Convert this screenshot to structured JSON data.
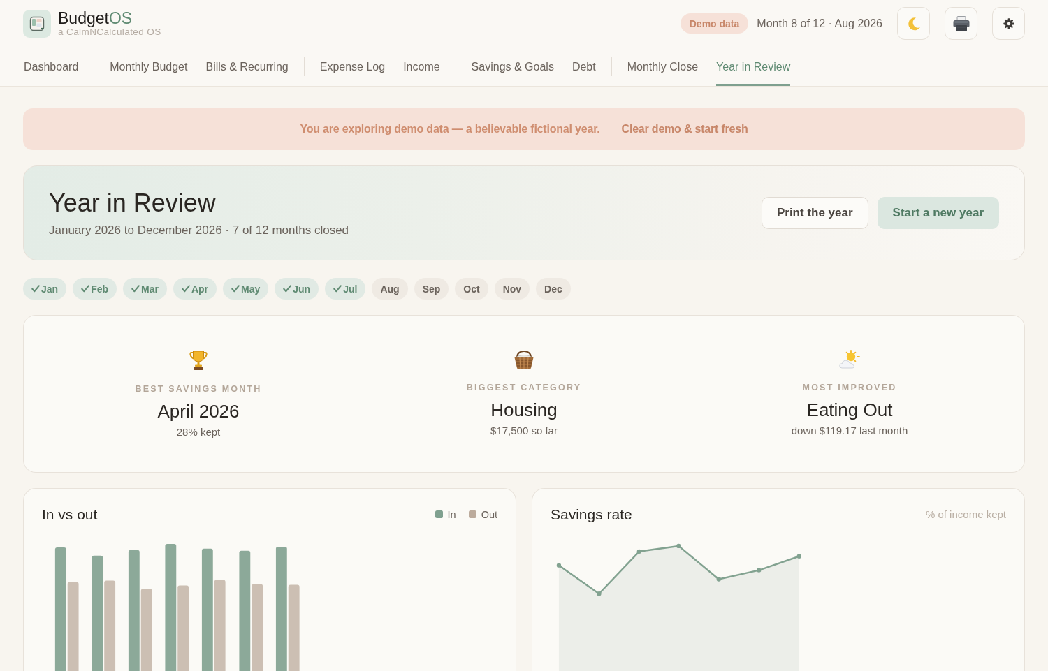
{
  "header": {
    "brand": {
      "name": "Budget",
      "accent": "OS",
      "tagline": "a CalmNCalculated OS"
    },
    "badge": "Demo data",
    "period": "Month 8 of 12 · Aug 2026"
  },
  "nav": {
    "groups": [
      {
        "items": [
          {
            "label": "Dashboard",
            "selected": false
          }
        ]
      },
      {
        "items": [
          {
            "label": "Monthly Budget",
            "selected": false
          },
          {
            "label": "Bills & Recurring",
            "selected": false
          }
        ]
      },
      {
        "items": [
          {
            "label": "Expense Log",
            "selected": false
          },
          {
            "label": "Income",
            "selected": false
          }
        ]
      },
      {
        "items": [
          {
            "label": "Savings & Goals",
            "selected": false
          },
          {
            "label": "Debt",
            "selected": false
          }
        ]
      },
      {
        "items": [
          {
            "label": "Monthly Close",
            "selected": false
          },
          {
            "label": "Year in Review",
            "selected": true
          }
        ]
      }
    ]
  },
  "banner": {
    "message": "You are exploring demo data — a believable fictional year.",
    "link": "Clear demo & start fresh"
  },
  "hero": {
    "title": "Year in Review",
    "subtitle": "January 2026 to December 2026 · 7 of 12 months closed",
    "buttons": [
      {
        "label": "Print the year",
        "kind": "secondary"
      },
      {
        "label": "Start a new year",
        "kind": "primary"
      }
    ]
  },
  "months": [
    {
      "label": "Jan",
      "closed": true
    },
    {
      "label": "Feb",
      "closed": true
    },
    {
      "label": "Mar",
      "closed": true
    },
    {
      "label": "Apr",
      "closed": true
    },
    {
      "label": "May",
      "closed": true
    },
    {
      "label": "Jun",
      "closed": true
    },
    {
      "label": "Jul",
      "closed": true
    },
    {
      "label": "Aug",
      "closed": false
    },
    {
      "label": "Sep",
      "closed": false
    },
    {
      "label": "Oct",
      "closed": false
    },
    {
      "label": "Nov",
      "closed": false
    },
    {
      "label": "Dec",
      "closed": false
    }
  ],
  "highlights": [
    {
      "kind": "savings",
      "label": "BEST SAVINGS MONTH",
      "value": "April 2026",
      "detail": "28% kept"
    },
    {
      "kind": "category",
      "label": "BIGGEST CATEGORY",
      "value": "Housing",
      "detail": "$17,500 so far"
    },
    {
      "kind": "improvement",
      "label": "MOST IMPROVED",
      "value": "Eating Out",
      "detail": "down $119.17 last month"
    }
  ],
  "in_vs_out": {
    "title": "In vs out",
    "legend": [
      {
        "label": "In",
        "color": "#7fa08f"
      },
      {
        "label": "Out",
        "color": "#bcab9c"
      }
    ]
  },
  "savings_rate": {
    "title": "Savings rate",
    "note": "% of income kept"
  }
}
